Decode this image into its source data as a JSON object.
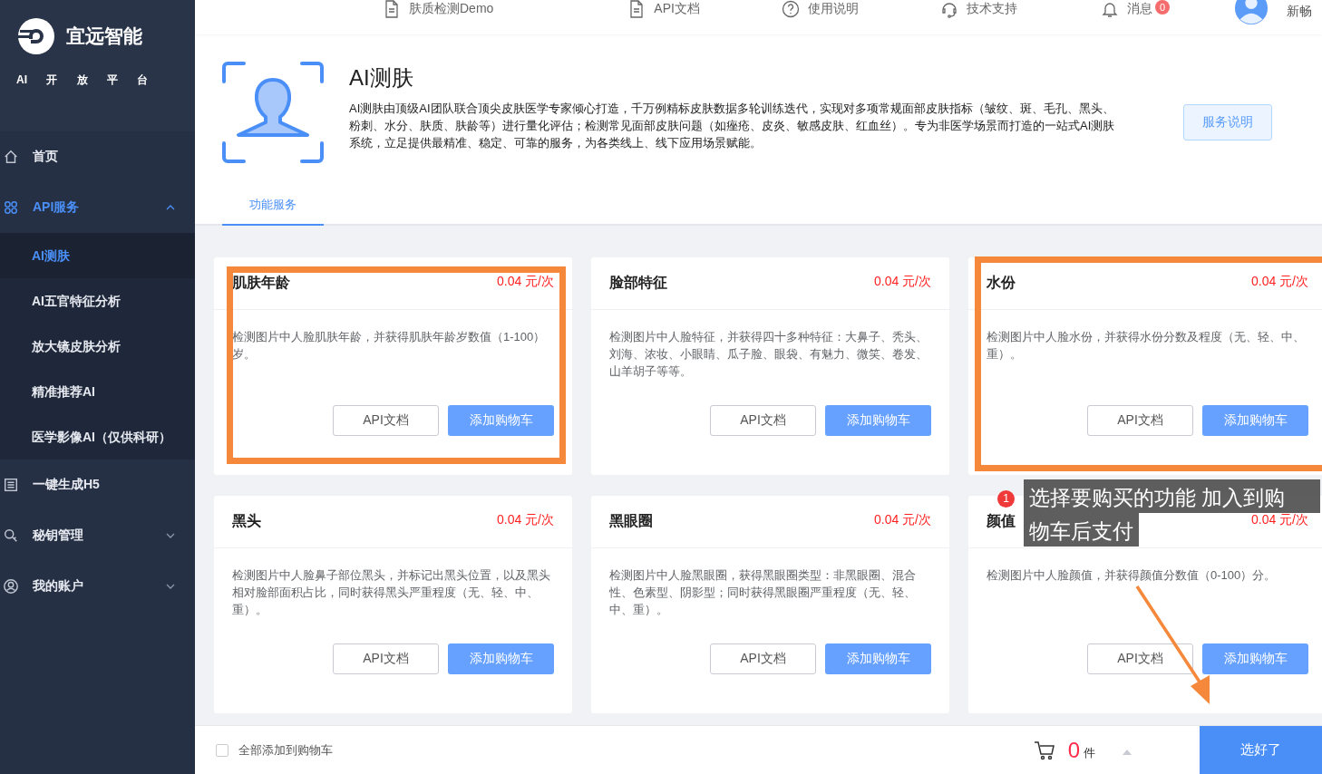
{
  "sidebar": {
    "brand": "宜远智能",
    "tagline": "AI 开 放 平 台",
    "menu": [
      {
        "kind": "link",
        "label": "首页",
        "selected": false
      },
      {
        "kind": "group",
        "label": "API服务",
        "selected": true,
        "expanded": true,
        "children": [
          {
            "label": "AI测肤",
            "selected": true
          },
          {
            "label": "AI五官特征分析",
            "selected": false
          },
          {
            "label": "放大镜皮肤分析",
            "selected": false
          },
          {
            "label": "精准推荐AI",
            "selected": false
          },
          {
            "label": "医学影像AI（仅供科研）",
            "selected": false
          }
        ]
      },
      {
        "kind": "link",
        "label": "一键生成H5",
        "selected": false
      },
      {
        "kind": "group",
        "label": "秘钥管理",
        "selected": false,
        "expanded": false
      },
      {
        "kind": "group",
        "label": "我的账户",
        "selected": false,
        "expanded": false
      }
    ]
  },
  "top_nav": [
    {
      "label": "肤质检测Demo"
    },
    {
      "label": "API文档"
    },
    {
      "label": "使用说明"
    },
    {
      "label": "技术支持"
    },
    {
      "label": "消息",
      "badge": "0"
    }
  ],
  "user": {
    "name": "新畅"
  },
  "service": {
    "title": "AI测肤",
    "description": "AI测肤由顶级AI团队联合顶尖皮肤医学专家倾心打造，千万例精标皮肤数据多轮训练迭代，实现对多项常规面部皮肤指标（皱纹、斑、毛孔、黑头、粉刺、水分、肤质、肤龄等）进行量化评估；检测常见面部皮肤问题（如痤疮、皮炎、敏感皮肤、红血丝）。专为非医学场景而打造的一站式AI测肤系统，立足提供最精准、稳定、可靠的服务，为各类线上、线下应用场景赋能。",
    "button": "服务说明"
  },
  "tabs": [
    {
      "label": "功能服务",
      "selected": true
    }
  ],
  "cards": [
    {
      "title": "肌肤年龄",
      "price": "0.04 元/次",
      "description": "检测图片中人脸肌肤年龄，并获得肌肤年龄岁数值（1-100）岁。",
      "doc_button": "API文档",
      "cart_button": "添加购物车"
    },
    {
      "title": "脸部特征",
      "price": "0.04 元/次",
      "description": "检测图片中人脸特征，并获得四十多种特征：大鼻子、秃头、刘海、浓妆、小眼睛、瓜子脸、眼袋、有魅力、微笑、卷发、山羊胡子等等。",
      "doc_button": "API文档",
      "cart_button": "添加购物车"
    },
    {
      "title": "水份",
      "price": "0.04 元/次",
      "description": "检测图片中人脸水份，并获得水份分数及程度（无、轻、中、重）。",
      "doc_button": "API文档",
      "cart_button": "添加购物车"
    },
    {
      "title": "黑头",
      "price": "0.04 元/次",
      "description": "检测图片中人脸鼻子部位黑头，并标记出黑头位置，以及黑头相对脸部面积占比，同时获得黑头严重程度（无、轻、中、重）。",
      "doc_button": "API文档",
      "cart_button": "添加购物车"
    },
    {
      "title": "黑眼圈",
      "price": "0.04 元/次",
      "description": "检测图片中人脸黑眼圈，获得黑眼圈类型：非黑眼圈、混合性、色素型、阴影型；同时获得黑眼圈严重程度（无、轻、中、重）。",
      "doc_button": "API文档",
      "cart_button": "添加购物车"
    },
    {
      "title": "颜值",
      "price": "0.04 元/次",
      "description": "检测图片中人脸颜值，并获得颜值分数值（0-100）分。",
      "doc_button": "API文档",
      "cart_button": "添加购物车"
    }
  ],
  "tooltip": {
    "badge": "1",
    "lines": [
      "选择要购买的功能 加入到购",
      "物车后支付"
    ]
  },
  "bottom_bar": {
    "select_all": {
      "label": "全部添加到购物车",
      "checked": false
    },
    "count": "0",
    "unit": "件",
    "button": "选好了"
  }
}
